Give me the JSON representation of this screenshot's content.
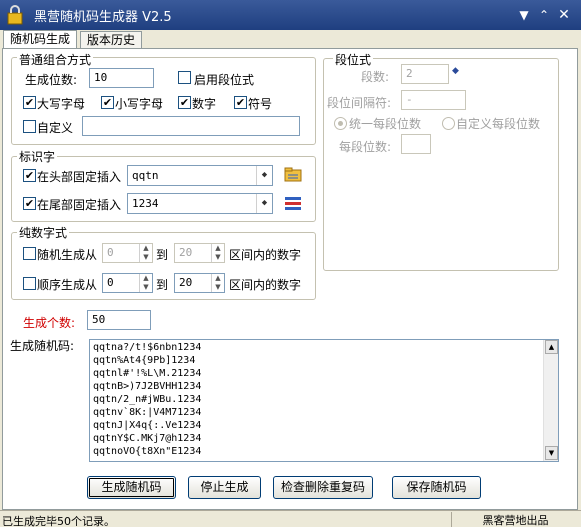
{
  "window": {
    "title": "黑营随机码生成器 V2.5"
  },
  "tabs": [
    {
      "label": "随机码生成"
    },
    {
      "label": "版本历史"
    }
  ],
  "normal": {
    "legend": "普通组合方式",
    "count_label": "生成位数:",
    "count_value": "10",
    "enable_segment": "启用段位式",
    "upper": "大写字母",
    "lower": "小写字母",
    "digit": "数字",
    "symbol": "符号",
    "custom": "自定义",
    "custom_value": ""
  },
  "segment": {
    "legend": "段位式",
    "seg_count_label": "段数:",
    "seg_count_value": "2",
    "sep_label": "段位间隔符:",
    "sep_value": "-",
    "uniform": "统一每段位数",
    "custom_each": "自定义每段位数",
    "per_seg_label": "每段位数:",
    "per_seg_value": ""
  },
  "mark": {
    "legend": "标识字",
    "head_label": "在头部固定插入",
    "head_value": "qqtn",
    "tail_label": "在尾部固定插入",
    "tail_value": "1234"
  },
  "pure": {
    "legend": "纯数字式",
    "random_label": "随机生成从",
    "random_from": "0",
    "to1": "到",
    "random_to": "20",
    "range1": "区间内的数字",
    "seq_label": "顺序生成从",
    "seq_from": "0",
    "to2": "到",
    "seq_to": "20",
    "range2": "区间内的数字"
  },
  "gen_count": {
    "label": "生成个数:",
    "value": "50"
  },
  "output": {
    "label": "生成随机码:",
    "lines": [
      "qqtna?/t!$6nbn1234",
      "qqtn%At4{9Pb]1234",
      "qqtnl#'!%L\\M.21234",
      "qqtnB>)7J2BVHH1234",
      "qqtn/2_n#jWBu.1234",
      "qqtnv`8K:|V4M71234",
      "qqtnJ|X4q{:.Ve1234",
      "qqtnY$C.MKj7@h1234",
      "qqtnoVO{t8Xn\"E1234"
    ]
  },
  "buttons": {
    "generate": "生成随机码",
    "stop": "停止生成",
    "dedupe": "检查删除重复码",
    "save": "保存随机码"
  },
  "status": {
    "left": "已生成完毕50个记录。",
    "right": "黑客营地出品"
  },
  "colors": {
    "title_bar": "#2a4a8a",
    "gen_count_label": "#d00000"
  }
}
